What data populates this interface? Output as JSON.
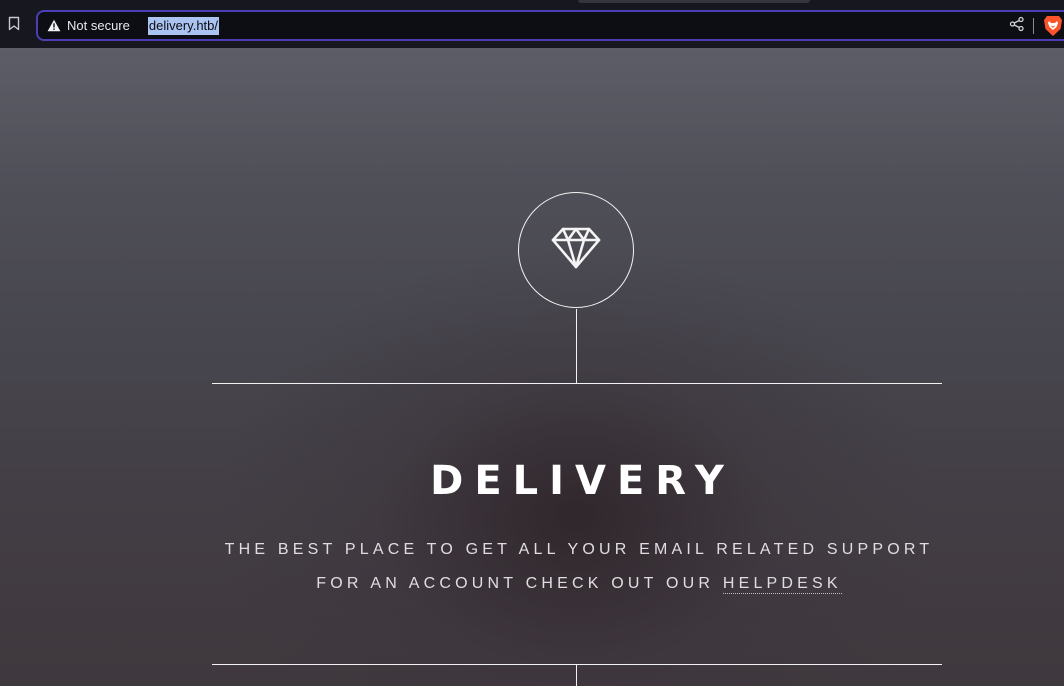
{
  "browser": {
    "security_label": "Not secure",
    "url": "delivery.htb/",
    "icons": {
      "bookmark": "bookmark-icon",
      "warning": "warning-triangle-icon",
      "share": "share-icon",
      "brave": "brave-lion-icon"
    },
    "accent_color": "#4a3fb4",
    "selection_color": "#aac3f1"
  },
  "page": {
    "logo_icon": "diamond-icon",
    "title": "DELIVERY",
    "tagline_line1": "THE BEST PLACE TO GET ALL YOUR EMAIL RELATED SUPPORT",
    "tagline_line2_prefix": "FOR AN ACCOUNT CHECK OUT OUR",
    "helpdesk_link": "HELPDESK"
  }
}
